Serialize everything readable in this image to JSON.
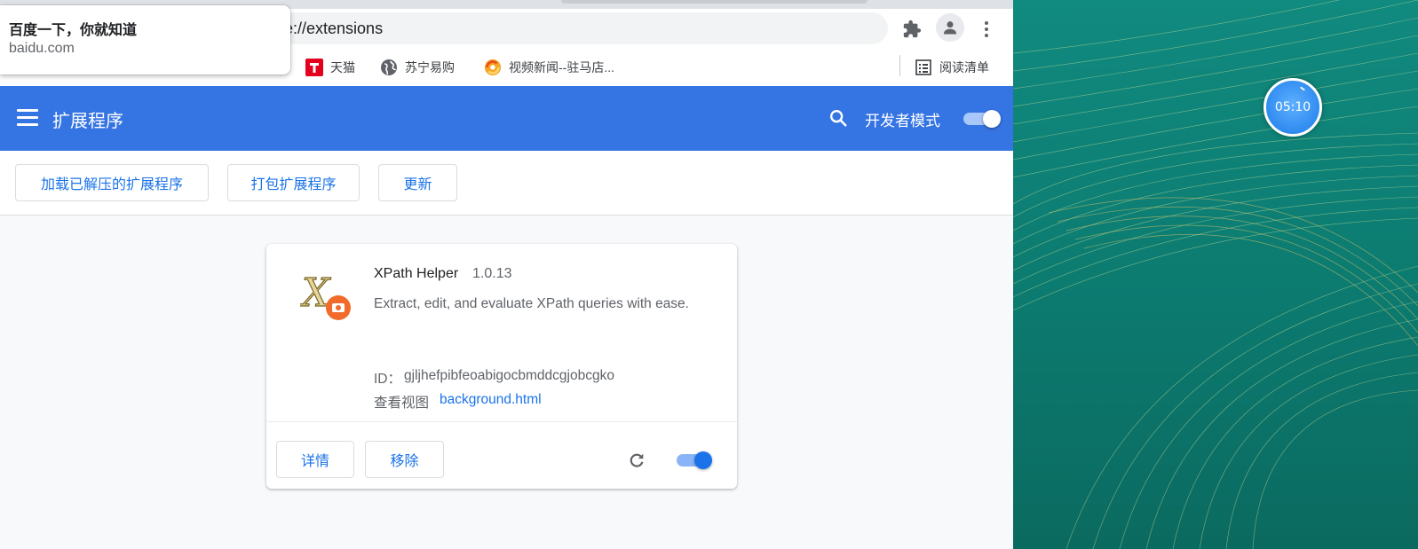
{
  "tooltip": {
    "title": "百度一下，你就知道",
    "url": "baidu.com"
  },
  "omnibox": {
    "url_text": "e://extensions"
  },
  "bookmarks": [
    {
      "label": "天猫",
      "icon": "tmall-icon"
    },
    {
      "label": "苏宁易购",
      "icon": "globe-icon"
    },
    {
      "label": "视频新闻--驻马店...",
      "icon": "news-icon"
    }
  ],
  "reading_list": {
    "label": "阅读清单"
  },
  "header": {
    "title": "扩展程序",
    "dev_mode_label": "开发者模式",
    "dev_mode_on": true
  },
  "actions": {
    "load_unpacked": "加载已解压的扩展程序",
    "pack": "打包扩展程序",
    "update": "更新"
  },
  "extension": {
    "name": "XPath Helper",
    "version": "1.0.13",
    "description": "Extract, edit, and evaluate XPath queries with ease.",
    "id_label": "ID：",
    "id": "gjljhefpibfeoabigocbmddcgjobcgko",
    "views_label": "查看视图",
    "views_link": "background.html",
    "details_button": "详情",
    "remove_button": "移除",
    "enabled": true
  },
  "desktop": {
    "timer": "05:10"
  },
  "colors": {
    "header_blue": "#3574e3",
    "link_blue": "#1a73e8",
    "desktop_teal": "#0f7a70"
  }
}
